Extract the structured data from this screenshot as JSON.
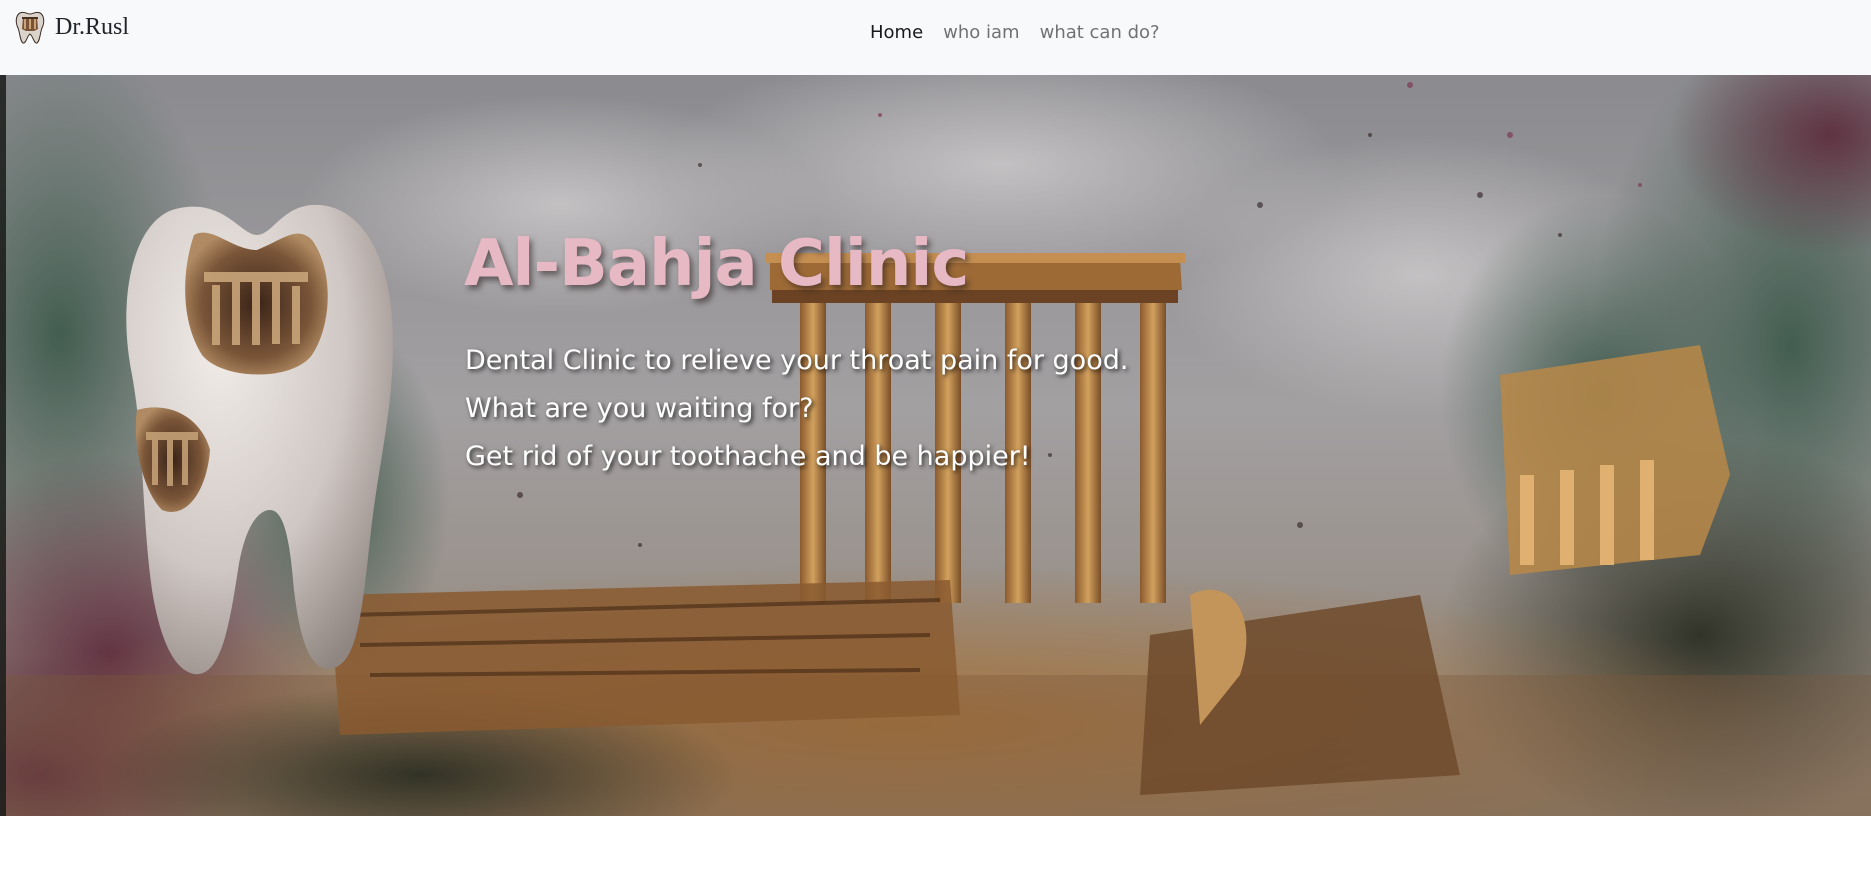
{
  "navbar": {
    "brand": {
      "logo_icon": "tooth-ruins-logo-icon",
      "text": "Dr.Rusl"
    },
    "links": [
      {
        "label": "Home",
        "active": true
      },
      {
        "label": "who iam",
        "active": false
      },
      {
        "label": "what can do?",
        "active": false
      }
    ],
    "background": "#f8f9fa"
  },
  "hero": {
    "background_image": "watercolor-temple-ruins-painting",
    "tooth_image": "tooth-with-carved-ruins-image",
    "title": "Al-Bahja Clinic",
    "title_color": "#e7b9c4",
    "lines": [
      "Dental Clinic to relieve your throat pain for good.",
      "What are you waiting for?",
      "Get rid of your toothache and be happier!"
    ]
  }
}
